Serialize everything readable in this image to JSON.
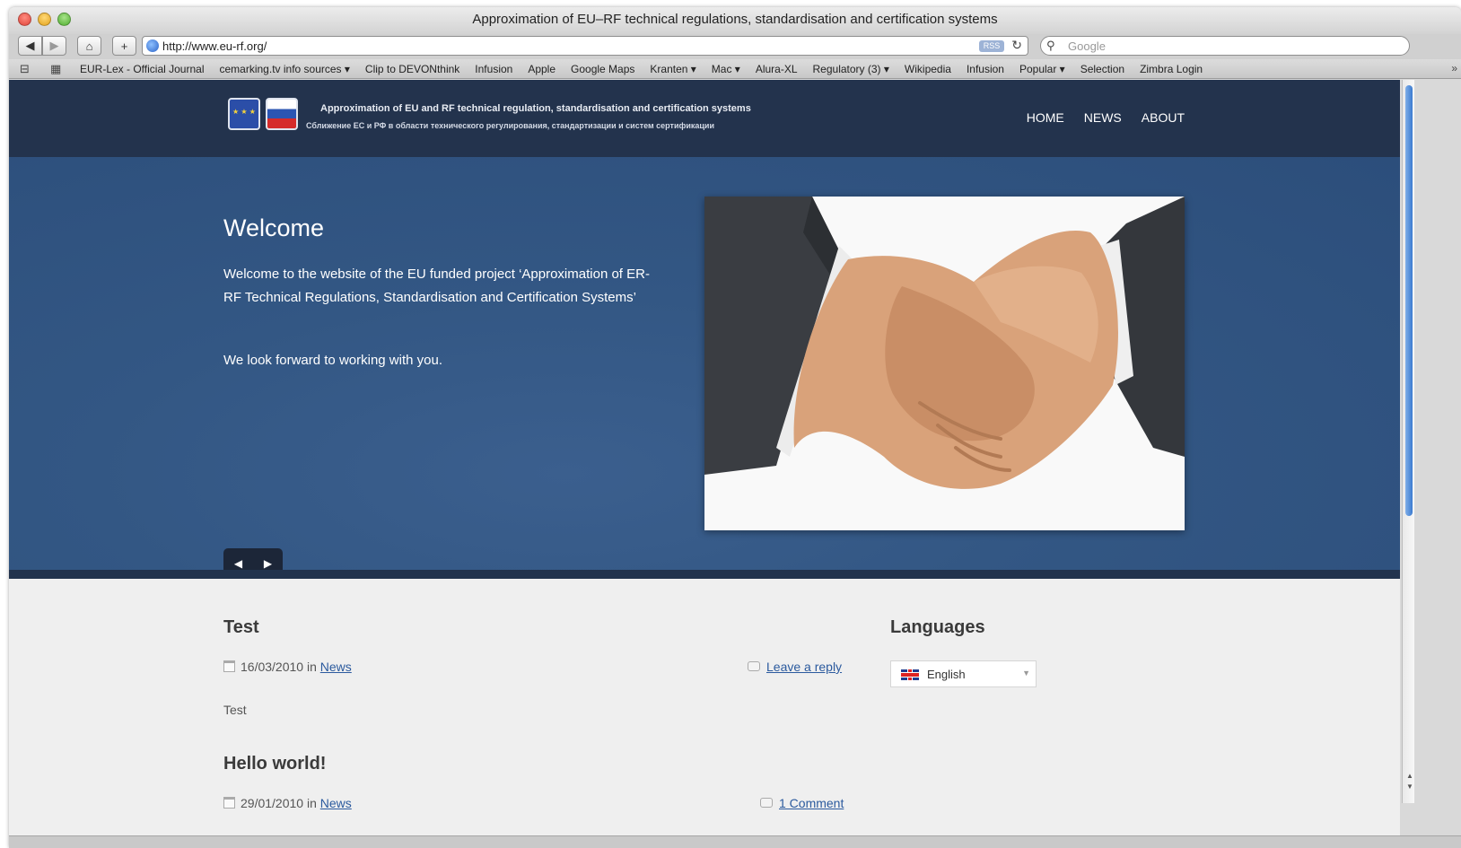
{
  "window": {
    "title": "Approximation of EU–RF technical regulations, standardisation and certification systems"
  },
  "toolbar": {
    "back_label": "◀",
    "forward_label": "▶",
    "home_label": "⌂",
    "add_label": "+",
    "url": "http://www.eu-rf.org/",
    "rss_label": "RSS",
    "reload_label": "↻",
    "search_placeholder": "Google"
  },
  "bookmarks": {
    "items": [
      "EUR-Lex - Official Journal",
      "cemarking.tv info sources ▾",
      "Clip to DEVONthink",
      "Infusion",
      "Apple",
      "Google Maps",
      "Kranten ▾",
      "Mac ▾",
      "Alura-XL",
      "Regulatory (3) ▾",
      "Wikipedia",
      "Infusion",
      "Popular ▾",
      "Selection",
      "Zimbra Login"
    ],
    "more_label": "»"
  },
  "site": {
    "tagline_en": "Approximation of EU and RF technical regulation, standardisation and certification systems",
    "tagline_ru": "Сближение ЕС и РФ в области технического регулирования, стандартизации и систем сертификации",
    "nav": [
      "HOME",
      "NEWS",
      "ABOUT"
    ]
  },
  "hero": {
    "title": "Welcome",
    "text": "Welcome to the website of the EU funded project ‘Approximation of ER-RF Technical Regulations, Standardisation and Certification Systems’",
    "text2": "We look forward to working with you.",
    "prev_label": "◀",
    "next_label": "▶"
  },
  "posts": [
    {
      "title": "Test",
      "date": "16/03/2010",
      "in_label": "in",
      "category": "News",
      "comments": "Leave a reply",
      "body": "Test"
    },
    {
      "title": "Hello world!",
      "date": "29/01/2010",
      "in_label": "in",
      "category": "News",
      "comments": "1 Comment"
    }
  ],
  "sidebar": {
    "title": "Languages",
    "language": "English"
  },
  "colors": {
    "header": "#23334d",
    "hero": "#335784",
    "link": "#2b5a9e"
  }
}
